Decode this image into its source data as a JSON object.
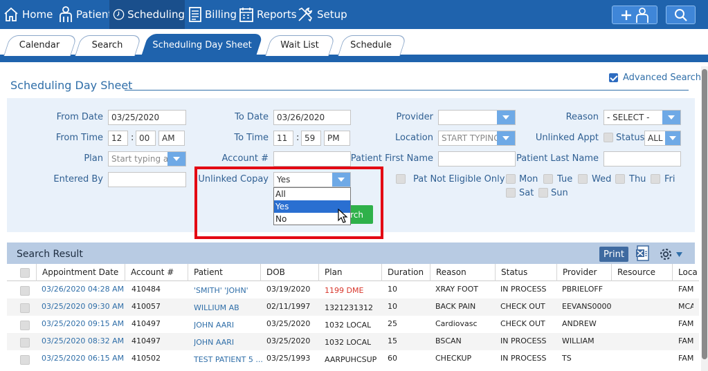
{
  "nav": {
    "home": "Home",
    "patient": "Patient",
    "scheduling": "Scheduling",
    "billing": "Billing",
    "reports": "Reports",
    "setup": "Setup"
  },
  "tabs": [
    "Calendar",
    "Search",
    "Scheduling Day Sheet",
    "Wait List",
    "Schedule"
  ],
  "page": {
    "title": "Scheduling Day Sheet",
    "advanced_search_label": "Advanced Search",
    "advanced_search_checked": true
  },
  "filters": {
    "from_date_label": "From Date",
    "from_date": "03/25/2020",
    "to_date_label": "To Date",
    "to_date": "03/26/2020",
    "provider_label": "Provider",
    "provider": "",
    "reason_label": "Reason",
    "reason": "- SELECT -",
    "from_time_label": "From Time",
    "from_hour": "12",
    "from_min": "00",
    "from_ampm": "AM",
    "to_time_label": "To Time",
    "to_hour": "11",
    "to_min": "59",
    "to_ampm": "PM",
    "location_label": "Location",
    "location_placeholder": "START TYPING",
    "unlinked_appt_label": "Unlinked Appt",
    "status_label": "Status",
    "status": "ALL",
    "plan_label": "Plan",
    "plan_placeholder": "Start typing a",
    "account_label": "Account #",
    "account": "",
    "patient_first_label": "Patient First Name",
    "patient_first": "",
    "patient_last_label": "Patient Last Name",
    "patient_last": "",
    "entered_by_label": "Entered By",
    "entered_by": "",
    "unlinked_copay_label": "Unlinked Copay",
    "unlinked_copay": "Yes",
    "unlinked_copay_options": [
      "All",
      "Yes",
      "No"
    ],
    "unlinked_copay_selected_index": 1,
    "pat_not_eligible_label": "Pat Not Eligible Only",
    "days": [
      "Mon",
      "Tue",
      "Wed",
      "Thu",
      "Fri",
      "Sat",
      "Sun"
    ],
    "search_button": "rch"
  },
  "results": {
    "title": "Search Result",
    "print_label": "Print",
    "columns": [
      "Appointment Date",
      "Account #",
      "Patient",
      "DOB",
      "Plan",
      "Duration",
      "Reason",
      "Status",
      "Provider",
      "Resource",
      "Loca"
    ],
    "rows": [
      {
        "date": "03/26/2020 04:28 AM",
        "account": "410484",
        "patient": "'SMITH' 'JOHN'",
        "dob": "03/19/2020",
        "plan": "1199 DME",
        "duration": "10",
        "reason": "XRAY FOOT",
        "status": "IN PROCESS",
        "provider": "PBRIELOFF",
        "resource": "",
        "loc": "FAM"
      },
      {
        "date": "03/25/2020 09:30 AM",
        "account": "410057",
        "patient": "WILLIUM AB",
        "dob": "02/11/1997",
        "plan": "1321231312",
        "duration": "10",
        "reason": "BACK PAIN",
        "status": "CHECK OUT",
        "provider": "EEVANS0000",
        "resource": "",
        "loc": "MCA"
      },
      {
        "date": "03/25/2020 09:15 AM",
        "account": "410497",
        "patient": "JOHN AARI",
        "dob": "03/25/2020",
        "plan": "1032 LOCAL",
        "duration": "25",
        "reason": "Cardiovasc",
        "status": "CHECK OUT",
        "provider": "ANDREW",
        "resource": "",
        "loc": "FAM"
      },
      {
        "date": "03/25/2020 08:32 AM",
        "account": "410497",
        "patient": "JOHN AARI",
        "dob": "03/25/2020",
        "plan": "1032 LOCAL",
        "duration": "15",
        "reason": "BSCAN",
        "status": "IN PROCESS",
        "provider": "WILLIAM",
        "resource": "",
        "loc": "FAM"
      },
      {
        "date": "03/25/2020 06:15 AM",
        "account": "410502",
        "patient": "TEST PATIENT 5 ...",
        "dob": "03/25/1993",
        "plan": "AARPUHCSUP",
        "duration": "60",
        "reason": "CHECKUP",
        "status": "IN PROCESS",
        "provider": "TS",
        "resource": "",
        "loc": "FAM"
      }
    ]
  }
}
